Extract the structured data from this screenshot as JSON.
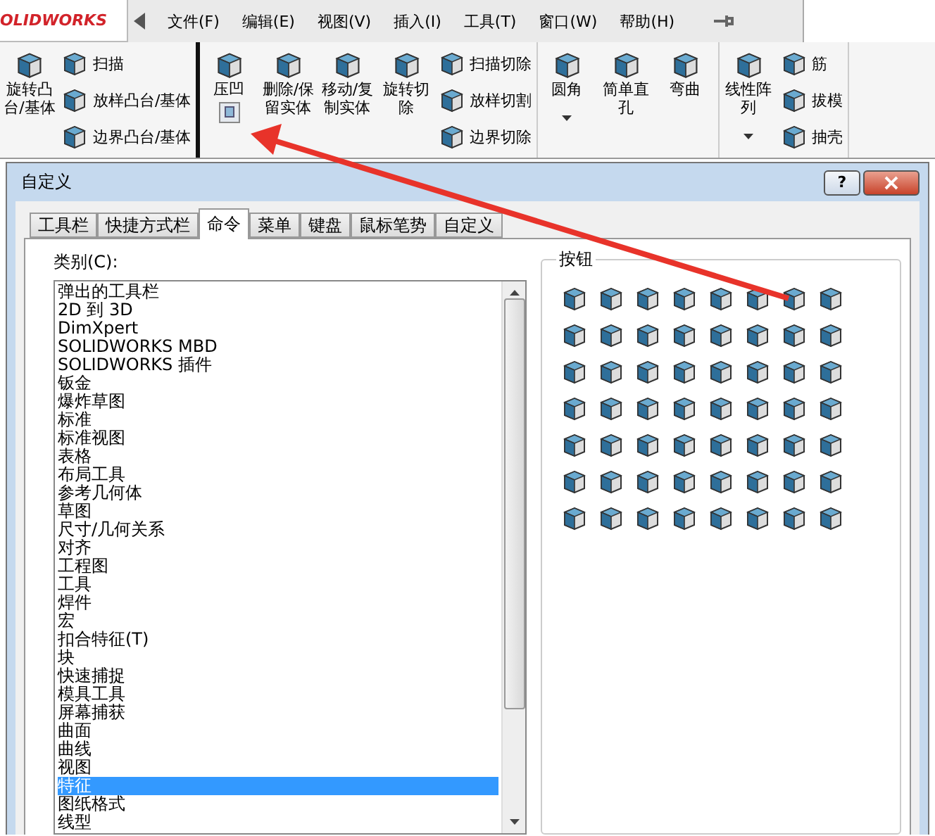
{
  "app": {
    "logo": "OLIDWORKS",
    "menus": [
      "文件(F)",
      "编辑(E)",
      "视图(V)",
      "插入(I)",
      "工具(T)",
      "窗口(W)",
      "帮助(H)"
    ]
  },
  "ribbon": {
    "groups": [
      {
        "items": [
          {
            "label": "旋转凸台/基体",
            "kind": "large",
            "dropdown": false
          },
          {
            "label": "扫描",
            "kind": "small"
          },
          {
            "label": "放样凸台/基体",
            "kind": "small"
          },
          {
            "label": "边界凸台/基体",
            "kind": "small"
          }
        ]
      },
      {
        "items": [
          {
            "label": "压凹",
            "kind": "large",
            "dropdown": false,
            "dropped_icon": true
          },
          {
            "label": "删除/保留实体",
            "kind": "large",
            "dropdown": false
          },
          {
            "label": "移动/复制实体",
            "kind": "large",
            "dropdown": false
          },
          {
            "label": "旋转切除",
            "kind": "large",
            "dropdown": false
          },
          {
            "label": "扫描切除",
            "kind": "small"
          },
          {
            "label": "放样切割",
            "kind": "small"
          },
          {
            "label": "边界切除",
            "kind": "small"
          }
        ]
      },
      {
        "items": [
          {
            "label": "圆角",
            "kind": "large",
            "dropdown": true
          },
          {
            "label": "简单直孔",
            "kind": "large",
            "dropdown": false
          },
          {
            "label": "弯曲",
            "kind": "large",
            "dropdown": false
          }
        ]
      },
      {
        "items": [
          {
            "label": "线性阵列",
            "kind": "large",
            "dropdown": true
          },
          {
            "label": "筋",
            "kind": "small"
          },
          {
            "label": "拔模",
            "kind": "small"
          },
          {
            "label": "抽壳",
            "kind": "small"
          }
        ]
      }
    ]
  },
  "dialog": {
    "title": "自定义",
    "help": "?",
    "tabs": [
      {
        "label": "工具栏",
        "selected": false
      },
      {
        "label": "快捷方式栏",
        "selected": false
      },
      {
        "label": "命令",
        "selected": true
      },
      {
        "label": "菜单",
        "selected": false
      },
      {
        "label": "键盘",
        "selected": false
      },
      {
        "label": "鼠标笔势",
        "selected": false
      },
      {
        "label": "自定义",
        "selected": false
      }
    ],
    "category_label": "类别(C):",
    "categories": [
      {
        "label": "弹出的工具栏",
        "selected": false
      },
      {
        "label": "2D 到 3D",
        "selected": false
      },
      {
        "label": "DimXpert",
        "selected": false
      },
      {
        "label": "SOLIDWORKS MBD",
        "selected": false
      },
      {
        "label": "SOLIDWORKS 插件",
        "selected": false
      },
      {
        "label": "钣金",
        "selected": false
      },
      {
        "label": "爆炸草图",
        "selected": false
      },
      {
        "label": "标准",
        "selected": false
      },
      {
        "label": "标准视图",
        "selected": false
      },
      {
        "label": "表格",
        "selected": false
      },
      {
        "label": "布局工具",
        "selected": false
      },
      {
        "label": "参考几何体",
        "selected": false
      },
      {
        "label": "草图",
        "selected": false
      },
      {
        "label": "尺寸/几何关系",
        "selected": false
      },
      {
        "label": "对齐",
        "selected": false
      },
      {
        "label": "工程图",
        "selected": false
      },
      {
        "label": "工具",
        "selected": false
      },
      {
        "label": "焊件",
        "selected": false
      },
      {
        "label": "宏",
        "selected": false
      },
      {
        "label": "扣合特征(T)",
        "selected": false
      },
      {
        "label": "块",
        "selected": false
      },
      {
        "label": "快速捕捉",
        "selected": false
      },
      {
        "label": "模具工具",
        "selected": false
      },
      {
        "label": "屏幕捕获",
        "selected": false
      },
      {
        "label": "曲面",
        "selected": false
      },
      {
        "label": "曲线",
        "selected": false
      },
      {
        "label": "视图",
        "selected": false
      },
      {
        "label": "特征",
        "selected": true
      },
      {
        "label": "图纸格式",
        "selected": false
      },
      {
        "label": "线型",
        "selected": false
      }
    ],
    "buttons_label": "按钮"
  }
}
